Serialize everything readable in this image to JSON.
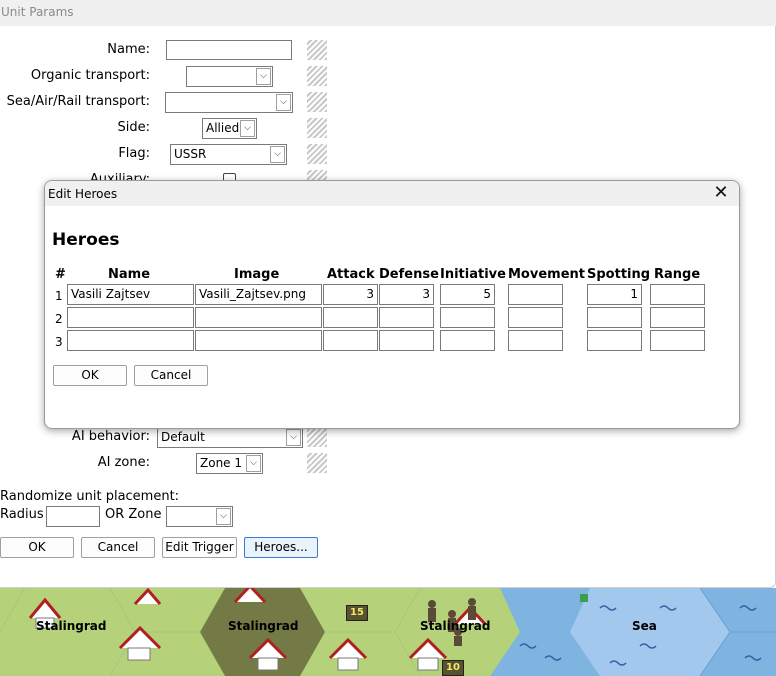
{
  "window": {
    "title": "Unit Params"
  },
  "fields": {
    "name": {
      "label": "Name:",
      "value": ""
    },
    "organic_transport": {
      "label": "Organic transport:",
      "value": ""
    },
    "sea_air_rail_transport": {
      "label": "Sea/Air/Rail transport:",
      "value": ""
    },
    "side": {
      "label": "Side:",
      "value": "Allied"
    },
    "flag": {
      "label": "Flag:",
      "value": "USSR"
    },
    "auxiliary": {
      "label": "Auxiliary:"
    },
    "ai_behavior": {
      "label": "AI behavior:",
      "value": "Default"
    },
    "ai_zone": {
      "label": "AI zone:",
      "value": "Zone 1"
    }
  },
  "randomize": {
    "heading": "Randomize unit placement:",
    "radius_label": "Radius",
    "radius_value": "",
    "zone_label": "OR Zone",
    "zone_value": ""
  },
  "buttons": {
    "ok": "OK",
    "cancel": "Cancel",
    "edit_trigger": "Edit Trigger",
    "heroes": "Heroes..."
  },
  "dialog": {
    "title": "Edit Heroes",
    "close_glyph": "✕",
    "heading": "Heroes",
    "columns": [
      "#",
      "Name",
      "Image",
      "Attack",
      "Defense",
      "Initiative",
      "Movement",
      "Spotting",
      "Range"
    ],
    "rows": [
      {
        "num": "1",
        "name": "Vasili Zajtsev",
        "image": "Vasili_Zajtsev.png",
        "attack": "3",
        "defense": "3",
        "initiative": "5",
        "movement": "",
        "spotting": "1",
        "range": ""
      },
      {
        "num": "2",
        "name": "",
        "image": "",
        "attack": "",
        "defense": "",
        "initiative": "",
        "movement": "",
        "spotting": "",
        "range": ""
      },
      {
        "num": "3",
        "name": "",
        "image": "",
        "attack": "",
        "defense": "",
        "initiative": "",
        "movement": "",
        "spotting": "",
        "range": ""
      }
    ],
    "ok": "OK",
    "cancel": "Cancel"
  },
  "map": {
    "labels": [
      "Stalingrad",
      "Stalingrad",
      "Stalingrad",
      "Sea"
    ],
    "badges": [
      "15",
      "10"
    ]
  },
  "icons": {
    "dropdown_arrow": "chevron-down-icon",
    "close": "close-icon",
    "resize_grip": "grip-icon"
  }
}
